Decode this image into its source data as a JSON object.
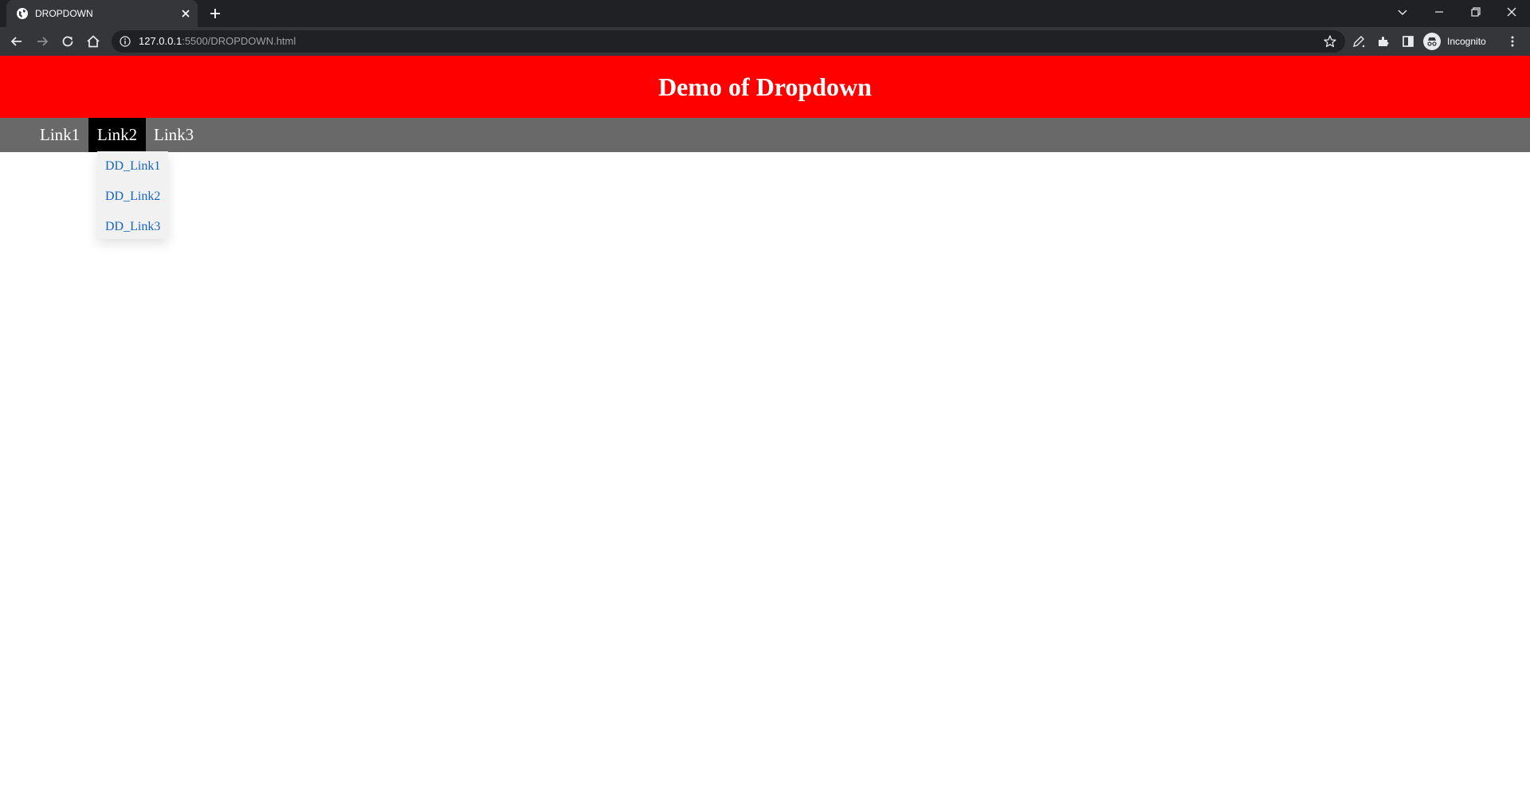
{
  "browser": {
    "tab_title": "DROPDOWN",
    "url_host": "127.0.0.1",
    "url_path": ":5500/DROPDOWN.html",
    "profile_label": "Incognito",
    "icons": [
      "globe-icon",
      "close-icon",
      "plus-icon",
      "chevron-down-icon",
      "minimize-icon",
      "restore-icon",
      "window-close-icon",
      "back-arrow-icon",
      "forward-arrow-icon",
      "reload-icon",
      "home-icon",
      "info-icon",
      "star-icon",
      "edit-pen-icon",
      "extensions-icon",
      "side-panel-icon",
      "incognito-icon",
      "more-menu-icon"
    ]
  },
  "page": {
    "title": "Demo of Dropdown",
    "nav": [
      {
        "label": "Link1"
      },
      {
        "label": "Link2"
      },
      {
        "label": "Link3"
      }
    ],
    "dropdown": [
      {
        "label": "DD_Link1"
      },
      {
        "label": "DD_Link2"
      },
      {
        "label": "DD_Link3"
      }
    ],
    "colors": {
      "header_bg": "#ff0000",
      "nav_bg": "#696969",
      "nav_active_bg": "#000000",
      "dropdown_bg": "#f1f1f1",
      "dropdown_link": "#1565c0"
    }
  }
}
